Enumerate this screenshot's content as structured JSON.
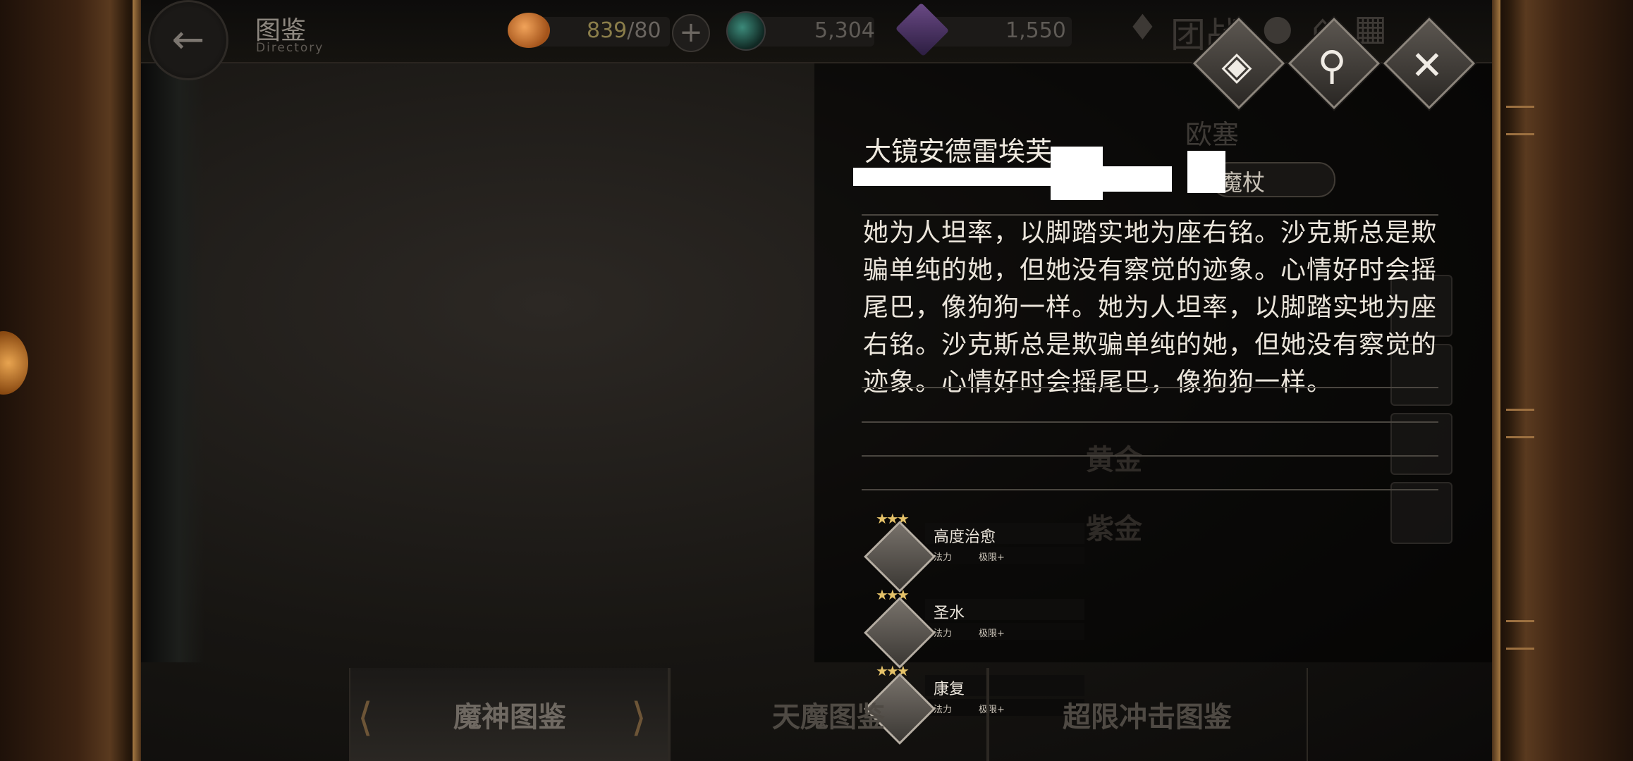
{
  "header": {
    "title": "图鉴",
    "subtitle": "Directory",
    "stamina": {
      "value": "839",
      "max": "/80",
      "icon": "bread-icon"
    },
    "crystal": {
      "value": "5,304",
      "icon": "potion-icon"
    },
    "gems": {
      "value": "1,550",
      "icon": "gem-icon"
    },
    "team_label": "团战"
  },
  "actions": {
    "voice": "speaker-icon",
    "search": "magnifier-icon",
    "close": "close-icon"
  },
  "character": {
    "name": "大镜安德雷埃芙",
    "weapon": "魔杖",
    "description": "她为人坦率，以脚踏实地为座右铭。沙克斯总是欺骗单纯的她，但她没有察觉的迹象。心情好时会摇尾巴，像狗狗一样。她为人坦率，以脚踏实地为座右铭。沙克斯总是欺骗单纯的她，但她没有察觉的迹象。心情好时会摇尾巴，像狗狗一样。"
  },
  "background_list": {
    "header": "欧塞",
    "items": [
      "黄金",
      "紫金"
    ]
  },
  "skills": [
    {
      "stars": "★★★",
      "name": "高度治愈",
      "type": "法力",
      "tag": "极限+"
    },
    {
      "stars": "★★★",
      "name": "圣水",
      "type": "法力",
      "tag": "极限+"
    },
    {
      "stars": "★★★",
      "name": "康复",
      "type": "法力",
      "tag": "极限+"
    }
  ],
  "tabs": [
    "魔神图鉴",
    "天魔图鉴",
    "超限冲击图鉴"
  ]
}
